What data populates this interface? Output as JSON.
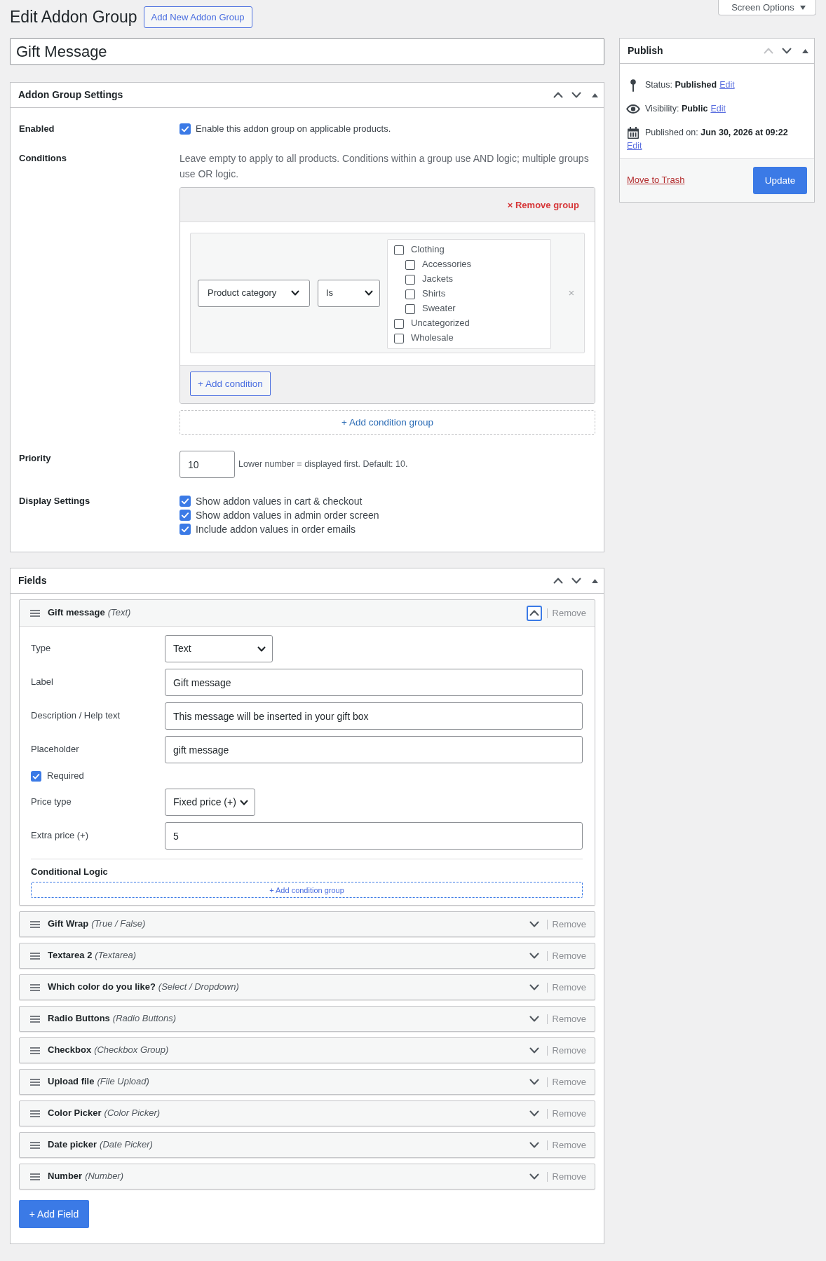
{
  "header": {
    "title": "Edit Addon Group",
    "add_new": "Add New Addon Group",
    "screen_options": "Screen Options"
  },
  "title_field": {
    "value": "Gift Message"
  },
  "settings_panel": {
    "title": "Addon Group Settings",
    "move_up_disabled": false,
    "enabled": {
      "label": "Enabled",
      "text": "Enable this addon group on applicable products.",
      "checked": true
    },
    "conditions": {
      "label": "Conditions",
      "help": "Leave empty to apply to all products. Conditions within a group use AND logic; multiple groups use OR logic.",
      "groups": [
        {
          "remove": "× Remove group",
          "rules": [
            {
              "field": "Product category",
              "operator": "Is",
              "remove": "×",
              "options": [
                {
                  "label": "Clothing",
                  "checked": false,
                  "children": [
                    {
                      "label": "Accessories",
                      "checked": false
                    },
                    {
                      "label": "Jackets",
                      "checked": false
                    },
                    {
                      "label": "Shirts",
                      "checked": false
                    },
                    {
                      "label": "Sweater",
                      "checked": false
                    }
                  ]
                },
                {
                  "label": "Uncategorized",
                  "checked": false
                },
                {
                  "label": "Wholesale",
                  "checked": false
                }
              ]
            }
          ],
          "add_condition": "+ Add condition"
        }
      ],
      "add_group": "+ Add condition group"
    },
    "priority": {
      "label": "Priority",
      "value": "10",
      "help": "Lower number = displayed first. Default: 10."
    },
    "display_settings": {
      "label": "Display Settings",
      "options": [
        {
          "label": "Show addon values in cart & checkout",
          "checked": true
        },
        {
          "label": "Show addon values in admin order screen",
          "checked": true
        },
        {
          "label": "Include addon values in order emails",
          "checked": true
        }
      ]
    }
  },
  "fields_panel": {
    "title": "Fields",
    "move_up_disabled": false,
    "items": [
      {
        "name": "Gift message",
        "type": "(Text)",
        "expanded": true,
        "remove": "Remove",
        "settings": {
          "rows": [
            {
              "kind": "select",
              "label": "Type",
              "value": "Text"
            },
            {
              "kind": "input",
              "label": "Label",
              "value": "Gift message"
            },
            {
              "kind": "input",
              "label": "Description / Help text",
              "value": "This message will be inserted in your gift box"
            },
            {
              "kind": "input",
              "label": "Placeholder",
              "value": "gift message"
            },
            {
              "kind": "checkbox",
              "label": "Required",
              "checked": true
            },
            {
              "kind": "select",
              "label": "Price type",
              "value": "Fixed price (+)"
            },
            {
              "kind": "input",
              "label": "Extra price (+)",
              "value": "5"
            }
          ],
          "conditional_logic": {
            "title": "Conditional Logic",
            "add_group": "+ Add condition group"
          }
        }
      },
      {
        "name": "Gift Wrap",
        "type": "(True / False)",
        "expanded": false,
        "remove": "Remove"
      },
      {
        "name": "Textarea 2",
        "type": "(Textarea)",
        "expanded": false,
        "remove": "Remove"
      },
      {
        "name": "Which color do you like?",
        "type": "(Select / Dropdown)",
        "expanded": false,
        "remove": "Remove"
      },
      {
        "name": "Radio Buttons",
        "type": "(Radio Buttons)",
        "expanded": false,
        "remove": "Remove"
      },
      {
        "name": "Checkbox",
        "type": "(Checkbox Group)",
        "expanded": false,
        "remove": "Remove"
      },
      {
        "name": "Upload file",
        "type": "(File Upload)",
        "expanded": false,
        "remove": "Remove"
      },
      {
        "name": "Color Picker",
        "type": "(Color Picker)",
        "expanded": false,
        "remove": "Remove"
      },
      {
        "name": "Date picker",
        "type": "(Date Picker)",
        "expanded": false,
        "remove": "Remove"
      },
      {
        "name": "Number",
        "type": "(Number)",
        "expanded": false,
        "remove": "Remove"
      }
    ],
    "add_field": "+ Add Field"
  },
  "publish": {
    "title": "Publish",
    "move_up_disabled": true,
    "status": {
      "text": "Status: **Published**",
      "edit": "Edit"
    },
    "visibility": {
      "text": "Visibility: **Public**",
      "edit": "Edit"
    },
    "schedule": {
      "text": "Published on: **Jun 30, 2026 at 09:22**",
      "edit": "Edit"
    },
    "trash": "Move to Trash",
    "update": "Update"
  }
}
